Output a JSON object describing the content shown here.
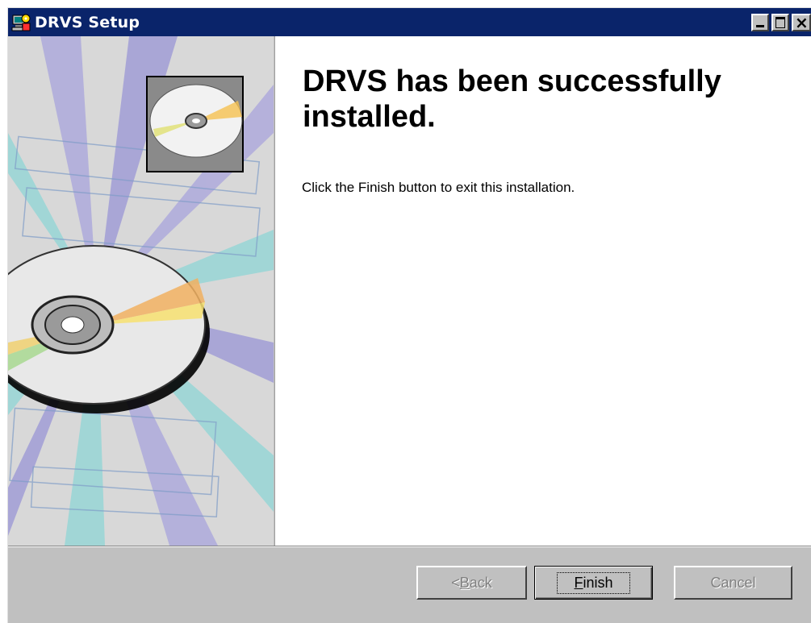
{
  "window": {
    "title": "DRVS Setup",
    "controls": [
      "minimize",
      "maximize",
      "close"
    ]
  },
  "content": {
    "heading": "DRVS has been successfully installed.",
    "message": "Click the Finish button to exit this installation."
  },
  "buttons": {
    "back": {
      "prefix": "< ",
      "accel": "B",
      "rest": "ack",
      "enabled": false
    },
    "finish": {
      "prefix": "",
      "accel": "F",
      "rest": "inish",
      "enabled": true,
      "default": true
    },
    "cancel": {
      "label": "Cancel",
      "enabled": false
    }
  },
  "colors": {
    "titlebar": "#0a246a",
    "dialog": "#c0c0c0"
  },
  "icons": {
    "app": "setup-computer-icon",
    "graphic": "cd-disc-banner"
  }
}
